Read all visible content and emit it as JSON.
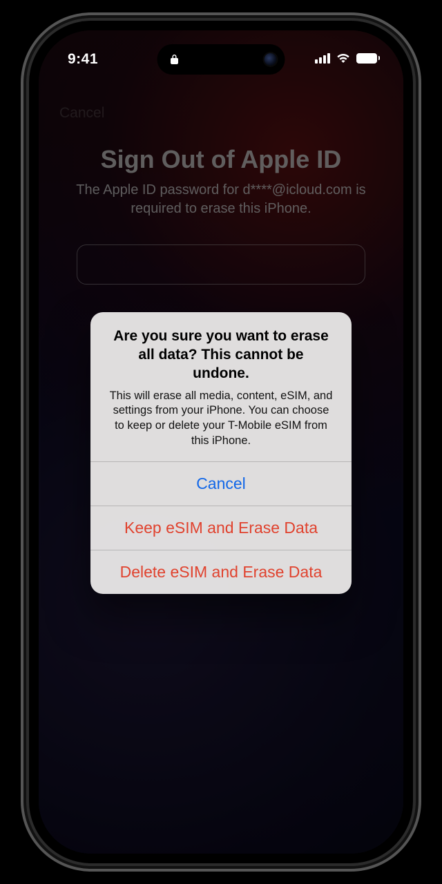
{
  "status": {
    "time": "9:41"
  },
  "background": {
    "cancel": "Cancel",
    "title": "Sign Out of Apple ID",
    "subtitle": "The Apple ID password for d****@icloud.com is required to erase this iPhone."
  },
  "sheet": {
    "title": "Are you sure you want to erase all data? This cannot be undone.",
    "message": "This will erase all media, content, eSIM, and settings from your iPhone. You can choose to keep or delete your T-Mobile eSIM from this iPhone.",
    "buttons": {
      "cancel": "Cancel",
      "keep": "Keep eSIM and Erase Data",
      "delete": "Delete eSIM and Erase Data"
    }
  }
}
